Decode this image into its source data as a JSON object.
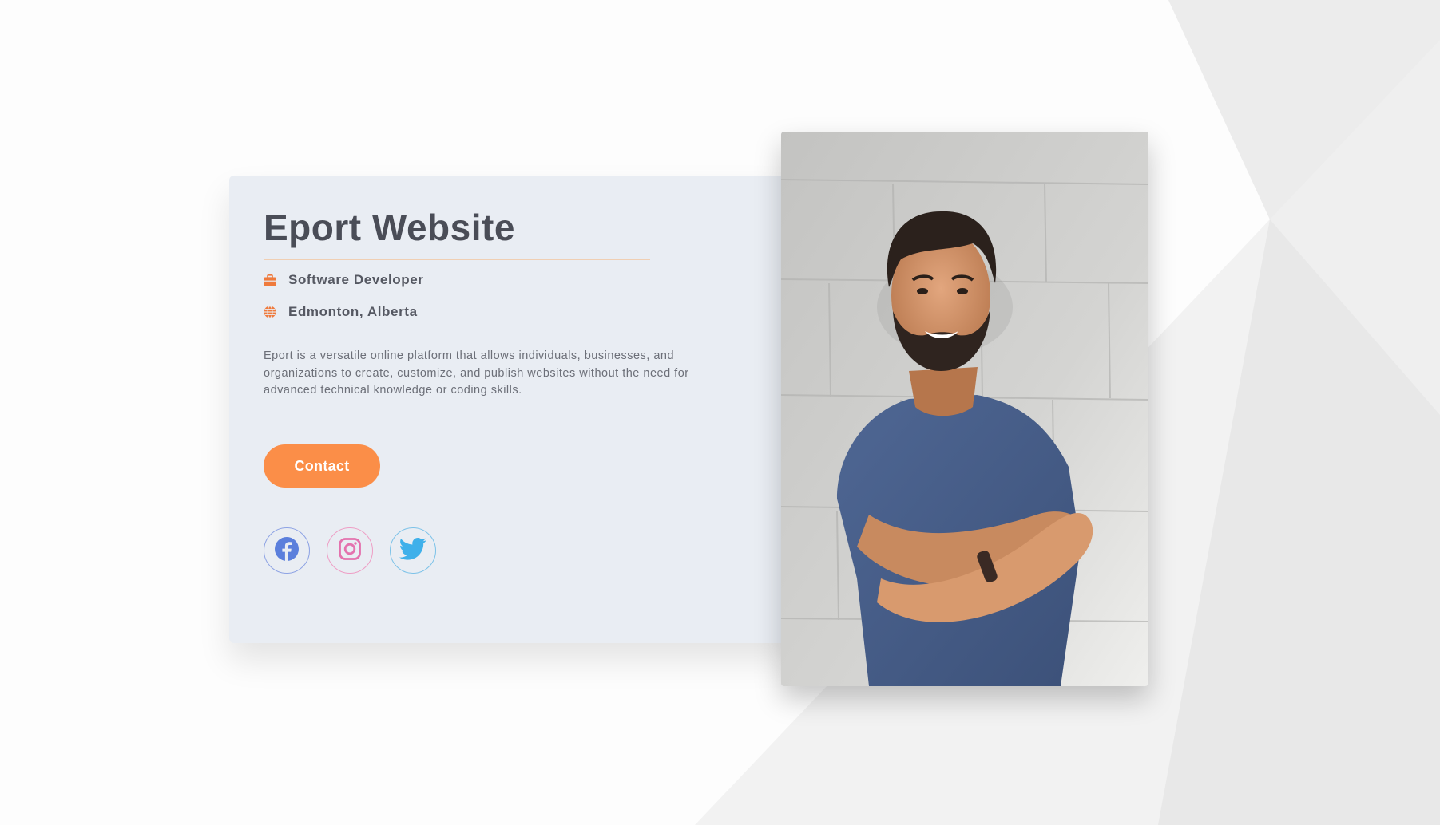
{
  "profile": {
    "title": "Eport Website",
    "job": "Software Developer",
    "location": "Edmonton, Alberta",
    "description": "Eport is a versatile online platform that allows individuals, businesses, and organizations to create, customize, and publish websites without the need for advanced technical knowledge or coding skills.",
    "contact_label": "Contact"
  },
  "icons": {
    "job": "briefcase-icon",
    "location": "globe-icon",
    "social": [
      "facebook-icon",
      "instagram-icon",
      "twitter-icon"
    ]
  },
  "colors": {
    "accent": "#fb8e48",
    "card_bg": "#e9edf3",
    "title": "#4a4d57",
    "facebook": "#5b7fdc",
    "instagram": "#e472ae",
    "twitter": "#3fb0ea"
  }
}
